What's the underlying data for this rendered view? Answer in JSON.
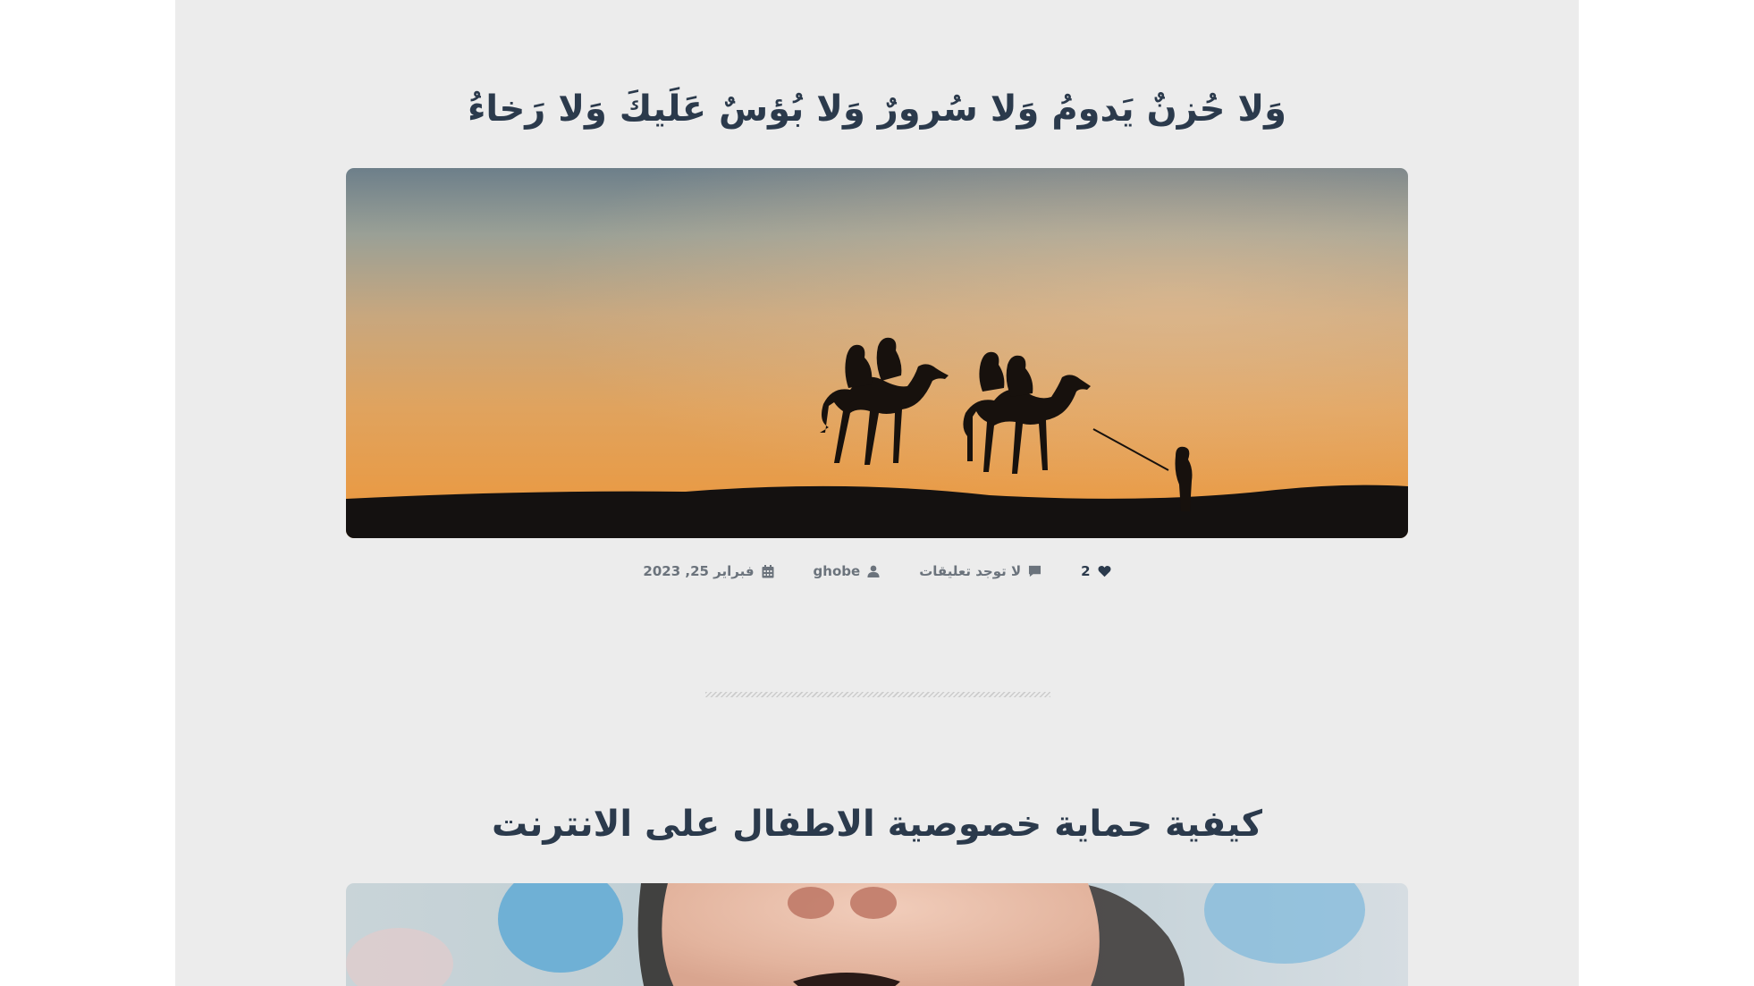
{
  "posts": [
    {
      "title": "وَلا حُزنٌ يَدومُ وَلا سُرورٌ وَلا بُؤسٌ عَلَيكَ وَلا رَخاءُ",
      "image": "camel-caravan-desert-sunset",
      "likes": "2",
      "comments": "لا توجد تعليقات",
      "author": "ghobe",
      "date": "فبراير 25, 2023"
    },
    {
      "title": "كيفية حماية خصوصية الاطفال على الانترنت",
      "image": "baby-face-closeup"
    }
  ],
  "icons": {
    "likes": "heart-icon",
    "comments": "comment-icon",
    "author": "user-icon",
    "date": "calendar-icon"
  },
  "colors": {
    "page_background": "#ececec",
    "outer_background": "#ffffff",
    "title": "#2b3a4c",
    "meta_text": "#6b737c"
  }
}
